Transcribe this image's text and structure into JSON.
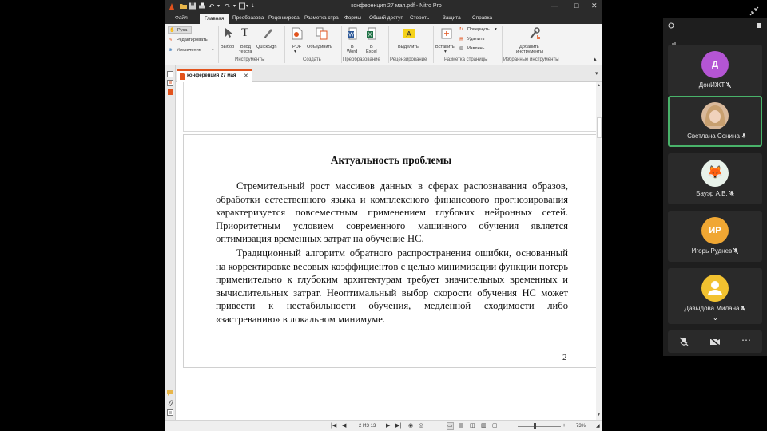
{
  "window": {
    "title": "конференция 27 мая.pdf - Nitro Pro",
    "minimize_glyph": "—",
    "restore_glyph": "□",
    "close_glyph": "✕"
  },
  "menu_tabs": [
    "Файл",
    "Главная",
    "Преобразова",
    "Рецензирова",
    "Разметка стра",
    "Формы",
    "Общий доступ",
    "Стереть",
    "Защита",
    "Справка"
  ],
  "ribbon": {
    "left_tools": {
      "hand": "Руса",
      "edit": "Редактировать",
      "zoom": "Увеличение"
    },
    "tools": {
      "select": "Выбор",
      "type_text_1": "Ввод",
      "type_text_2": "текста",
      "quicksign": "QuickSign",
      "group": "Инструменты"
    },
    "create": {
      "pdf": "PDF",
      "combine": "Объединить",
      "group": "Создать"
    },
    "convert": {
      "to_word_1": "В",
      "to_word_2": "Word",
      "to_excel_1": "В",
      "to_excel_2": "Excel",
      "group": "Преобразование"
    },
    "review": {
      "highlight": "Выделить",
      "group": "Рецензирование"
    },
    "page_layout": {
      "insert": "Вставить",
      "rotate": "Повернуть",
      "delete": "Удалить",
      "extract": "Извлечь",
      "group": "Разметка страницы"
    },
    "favorites": {
      "add_1": "Добавить",
      "add_2": "инструменты",
      "group": "Избранные инструменты"
    }
  },
  "document_tab": {
    "label": "конференция 27 мая",
    "close": "✕"
  },
  "document": {
    "heading": "Актуальность проблемы",
    "paragraph1": "Стремительный рост массивов данных в сферах распознавания образов, обработки естественного языка и комплексного финансового прогнозирования характеризуется повсеместным применением глубоких нейронных сетей. Приоритетным условием современного машинного обучения является оптимизация временных затрат на обучение НС.",
    "paragraph2": "Традиционный алгоритм обратного распространения ошибки, основанный на корректировке весовых коэффициентов с целью минимизации функции потерь применительно к глубоким архитектурам требует значительных временных и вычислительных затрат. Неоптимальный выбор скорости обучения НС может привести к нестабильности обучения, медленной сходимости либо «застреванию» в локальном минимуме.",
    "page_number": "2"
  },
  "status": {
    "page_indicator": "2 ИЗ 13",
    "zoom": "73%"
  },
  "meeting": {
    "participants": [
      {
        "initials": "Д",
        "name": "ДонИЖТ",
        "color": "#b455d4",
        "muted": true
      },
      {
        "initials": "",
        "name": "Светлана Сонина",
        "color": "#c89a7a",
        "muted": false,
        "active": true
      },
      {
        "initials": "🦊",
        "name": "Бауэр А.В.",
        "color": "#e8f2ea",
        "muted": true
      },
      {
        "initials": "ИР",
        "name": "Игорь Руднев",
        "color": "#f0a733",
        "muted": true
      },
      {
        "initials": "",
        "name": "Давыдова Милана",
        "color": "#f2c230",
        "muted": true
      }
    ]
  }
}
